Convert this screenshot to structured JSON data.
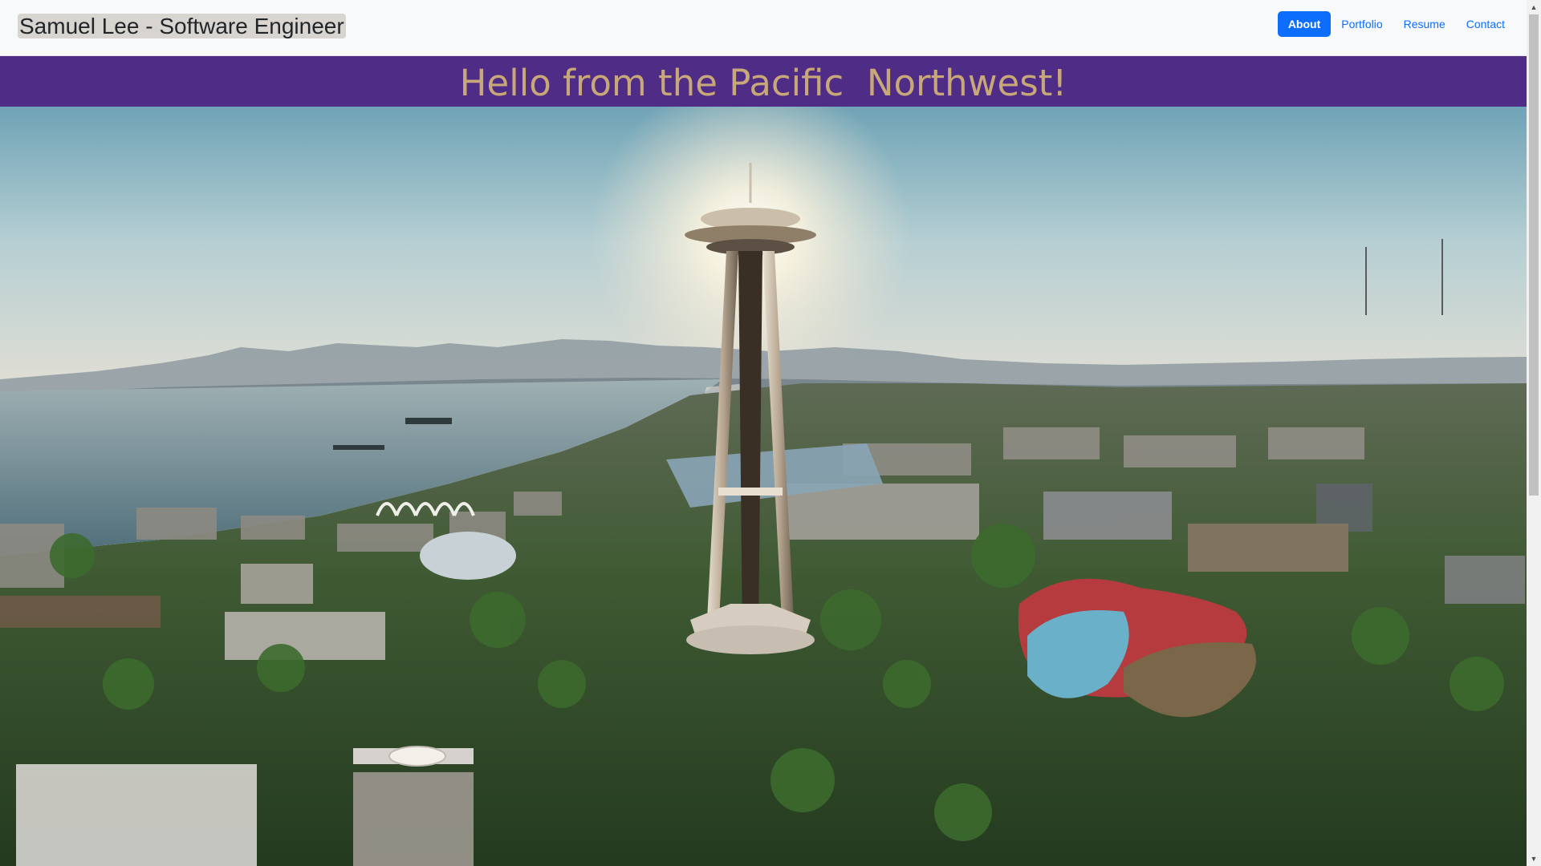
{
  "navbar": {
    "brand": "Samuel Lee - Software Engineer",
    "links": [
      {
        "label": "About",
        "active": true
      },
      {
        "label": "Portfolio",
        "active": false
      },
      {
        "label": "Resume",
        "active": false
      },
      {
        "label": "Contact",
        "active": false
      }
    ]
  },
  "hero": {
    "title": "Hello from the Pacific  Northwest!",
    "image_alt": "Aerial view of the Space Needle and Seattle at sunrise",
    "banner_color": "#4f2d87",
    "title_color": "#c8a779"
  },
  "colors": {
    "accent": "#0d6efd",
    "navbar_bg": "#f8f9fa"
  },
  "scrollbar": {
    "up_icon": "triangle-up-icon",
    "down_icon": "triangle-down-icon"
  }
}
